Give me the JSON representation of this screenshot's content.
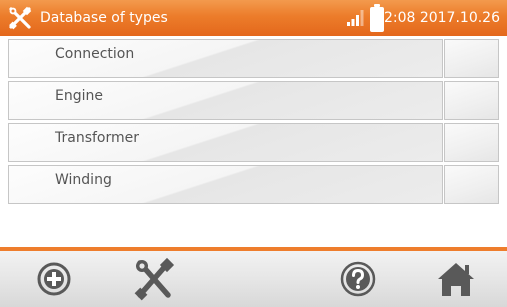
{
  "header": {
    "title": "Database of types",
    "datetime": "12:08 2017.10.26",
    "icons": {
      "tools": "tools-icon",
      "signal": "signal-icon",
      "battery": "battery-icon"
    }
  },
  "list": {
    "items": [
      {
        "label": "Connection"
      },
      {
        "label": "Engine"
      },
      {
        "label": "Transformer"
      },
      {
        "label": "Winding"
      }
    ]
  },
  "toolbar": {
    "buttons": [
      {
        "icon": "add-circle-icon"
      },
      {
        "icon": "tools-icon"
      },
      {
        "icon": "help-icon"
      },
      {
        "icon": "home-icon"
      }
    ]
  },
  "colors": {
    "header": "#ec7c2a",
    "accent_line": "#ee7d2c",
    "icon_dark": "#595959",
    "text": "#555555",
    "row_border": "#c6c6c6"
  }
}
